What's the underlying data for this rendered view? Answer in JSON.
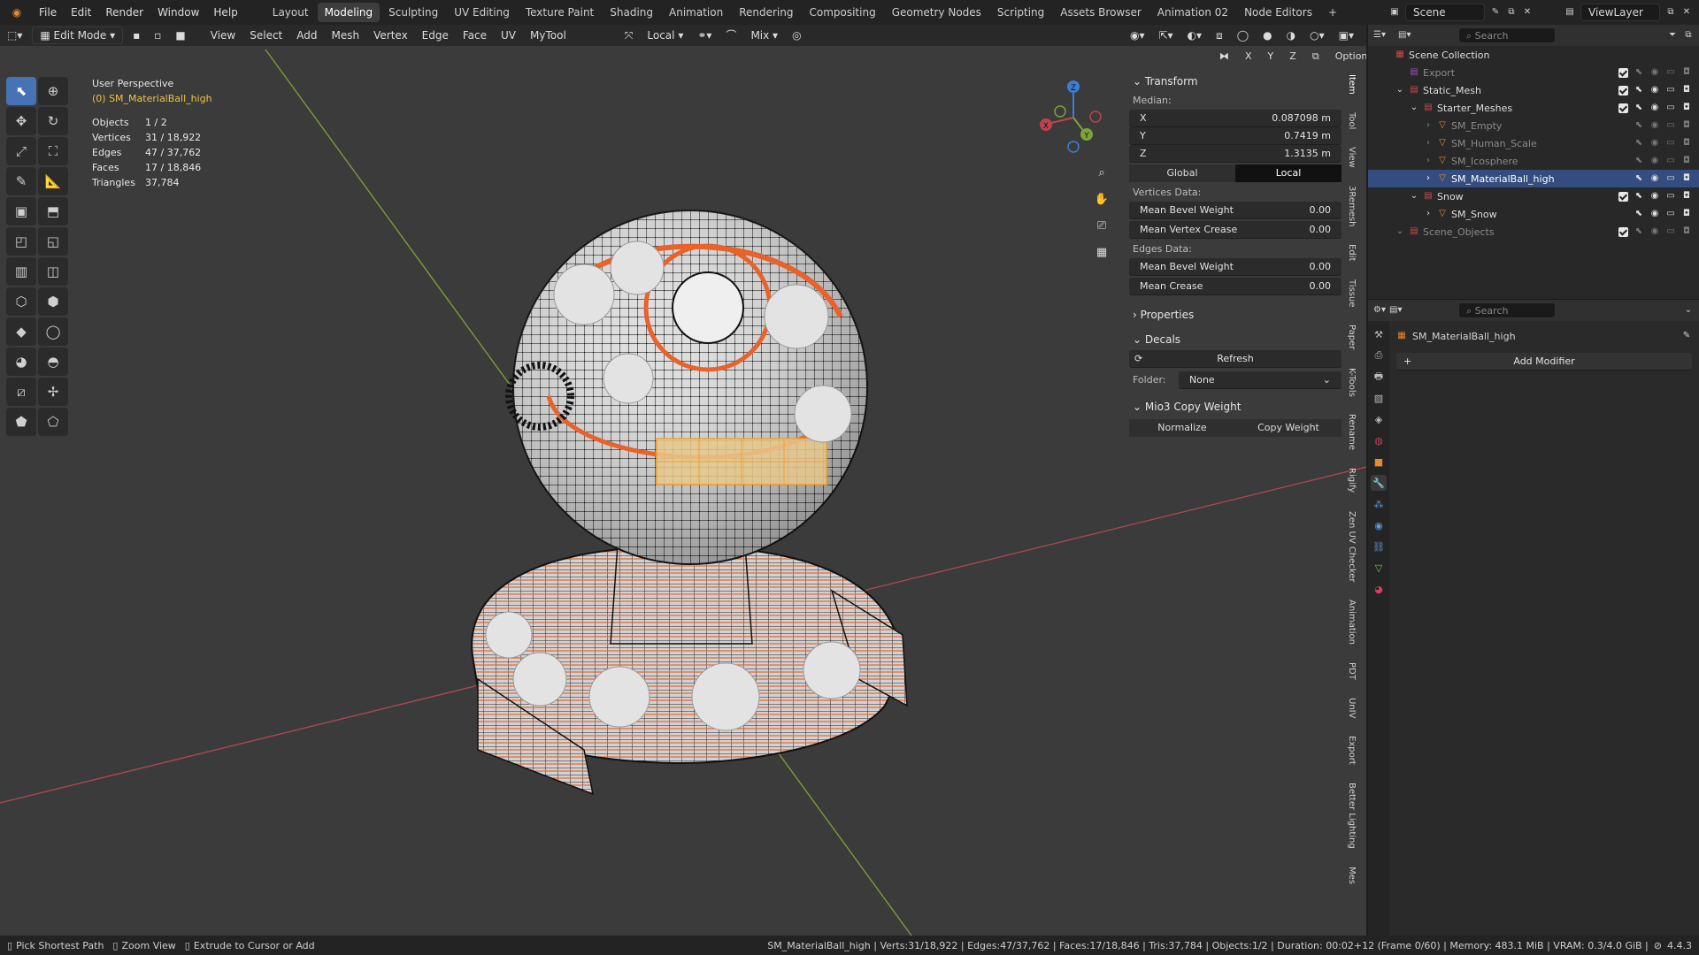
{
  "menu": [
    "File",
    "Edit",
    "Render",
    "Window",
    "Help"
  ],
  "workspaces": [
    "Layout",
    "Modeling",
    "Sculpting",
    "UV Editing",
    "Texture Paint",
    "Shading",
    "Animation",
    "Rendering",
    "Compositing",
    "Geometry Nodes",
    "Scripting",
    "Assets Browser",
    "Animation 02",
    "Node Editors"
  ],
  "active_workspace": "Modeling",
  "scene": "Scene",
  "view_layer": "ViewLayer",
  "search_placeholder": "Search",
  "viewport_header": {
    "mode": "Edit Mode",
    "menus": [
      "View",
      "Select",
      "Add",
      "Mesh",
      "Vertex",
      "Edge",
      "Face",
      "UV",
      "MyTool"
    ],
    "orientation": "Local",
    "snap": "Mix",
    "axes": [
      "X",
      "Y",
      "Z"
    ],
    "options": "Options"
  },
  "info": {
    "view": "User Perspective",
    "object": "(0) SM_MaterialBall_high",
    "rows": [
      {
        "k": "Objects",
        "v": "1 / 2"
      },
      {
        "k": "Vertices",
        "v": "31 / 18,922"
      },
      {
        "k": "Edges",
        "v": "47 / 37,762"
      },
      {
        "k": "Faces",
        "v": "17 / 18,846"
      },
      {
        "k": "Triangles",
        "v": "37,784"
      }
    ]
  },
  "gizmo": {
    "x": "X",
    "y": "Y",
    "z": "Z"
  },
  "npanel": {
    "transform": "Transform",
    "median": "Median:",
    "x_lbl": "X",
    "x": "0.087098 m",
    "y_lbl": "Y",
    "y": "0.7419 m",
    "z_lbl": "Z",
    "z": "1.3135 m",
    "global": "Global",
    "local": "Local",
    "vertices_data": "Vertices Data:",
    "mean_bevel_weight": "Mean Bevel Weight",
    "mbw_v": "0.00",
    "mean_vertex_crease": "Mean Vertex Crease",
    "mvc_v": "0.00",
    "edges_data": "Edges Data:",
    "mean_bevel_weight2": "Mean Bevel Weight",
    "mbw2_v": "0.00",
    "mean_crease": "Mean Crease",
    "mc_v": "0.00",
    "properties": "Properties",
    "decals": "Decals",
    "refresh": "Refresh",
    "folder_lbl": "Folder:",
    "folder": "None",
    "mio3": "Mio3 Copy Weight",
    "normalize": "Normalize",
    "copy_weight": "Copy Weight"
  },
  "side_tabs": [
    "Item",
    "Tool",
    "View",
    "3Remesh",
    "Edit",
    "Tissue",
    "Paper",
    "K-Tools",
    "Rename",
    "Rigify",
    "Zen UV Checker",
    "Animation",
    "PDT",
    "UnIV",
    "Export",
    "Better Lighting",
    "Mes"
  ],
  "outliner": {
    "rows": [
      {
        "name": "Scene Collection",
        "indent": 0,
        "type": "scene",
        "dim": false,
        "sel": false
      },
      {
        "name": "Export",
        "indent": 1,
        "type": "coll_purple",
        "dim": true,
        "sel": false
      },
      {
        "name": "Static_Mesh",
        "indent": 1,
        "type": "coll",
        "dim": false,
        "sel": false
      },
      {
        "name": "Starter_Meshes",
        "indent": 2,
        "type": "coll",
        "dim": false,
        "sel": false
      },
      {
        "name": "SM_Empty",
        "indent": 3,
        "type": "mesh",
        "dim": true,
        "sel": false
      },
      {
        "name": "SM_Human_Scale",
        "indent": 3,
        "type": "mesh",
        "dim": true,
        "sel": false
      },
      {
        "name": "SM_Icosphere",
        "indent": 3,
        "type": "mesh",
        "dim": true,
        "sel": false
      },
      {
        "name": "SM_MaterialBall_high",
        "indent": 3,
        "type": "mesh",
        "dim": false,
        "sel": true
      },
      {
        "name": "Snow",
        "indent": 2,
        "type": "coll",
        "dim": false,
        "sel": false
      },
      {
        "name": "SM_Snow",
        "indent": 3,
        "type": "mesh",
        "dim": false,
        "sel": false
      },
      {
        "name": "Scene_Objects",
        "indent": 1,
        "type": "coll",
        "dim": true,
        "sel": false
      }
    ]
  },
  "properties": {
    "object": "SM_MaterialBall_high",
    "add_modifier": "Add Modifier",
    "search_placeholder": "Search"
  },
  "statusbar": {
    "left": [
      {
        "key": "Pick Shortest Path"
      },
      {
        "key": "Zoom View"
      },
      {
        "key": "Extrude to Cursor or Add"
      }
    ],
    "right": "SM_MaterialBall_high | Verts:31/18,922 | Edges:47/37,762 | Faces:17/18,846 | Tris:37,784 | Objects:1/2 | Duration: 00:02+12 (Frame 0/60) | Memory: 483.1 MiB | VRAM: 0.3/4.0 GiB |",
    "version": "4.4.3"
  },
  "colors": {
    "accent": "#4772b3",
    "selected": "#334d80",
    "axis_x": "#c0424e",
    "axis_y": "#7ea33a",
    "edge": "#e8622c",
    "mesh": "#d8d8d8"
  }
}
